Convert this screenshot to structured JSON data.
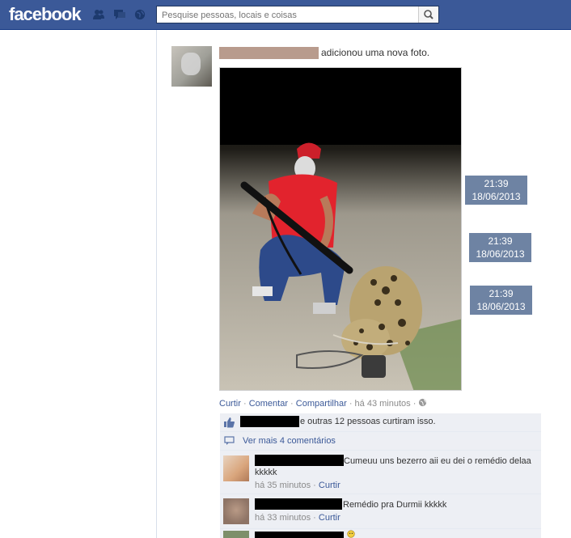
{
  "topbar": {
    "logo": "facebook",
    "search_placeholder": "Pesquise pessoas, locais e coisas"
  },
  "story": {
    "action_text": "adicionou uma nova foto."
  },
  "timestamps": [
    {
      "time": "21:39",
      "date": "18/06/2013"
    },
    {
      "time": "21:39",
      "date": "18/06/2013"
    },
    {
      "time": "21:39",
      "date": "18/06/2013"
    }
  ],
  "actions": {
    "like": "Curtir",
    "comment": "Comentar",
    "share": "Compartilhar",
    "time": "há 43 minutos",
    "sep": "·"
  },
  "likes": {
    "text": "e outras 12 pessoas curtiram isso."
  },
  "more_comments": "Ver mais 4 comentários",
  "comments": [
    {
      "text": "Cumeuu uns bezerro aii eu dei o remédio delaa",
      "text2": "kkkkk",
      "time": "há 35 minutos",
      "like": "Curtir"
    },
    {
      "text": "Remédio pra Durmii kkkkk",
      "time": "há 33 minutos",
      "like": "Curtir"
    }
  ],
  "colors": {
    "brand": "#3b5998",
    "ufi_bg": "#edeff4",
    "stamp": "#6e83a3"
  }
}
